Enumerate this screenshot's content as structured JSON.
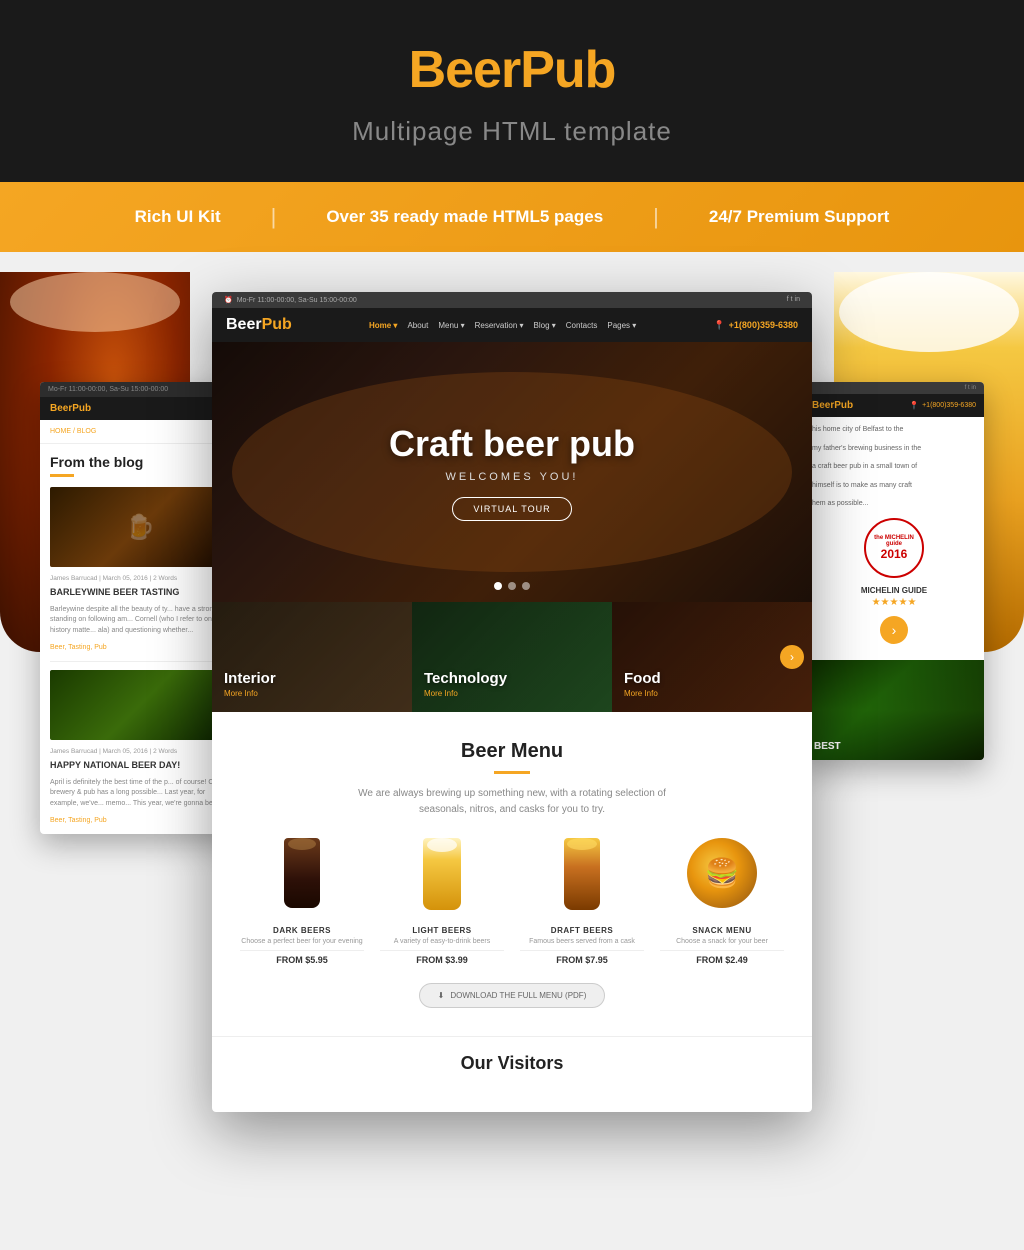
{
  "header": {
    "logo_beer": "Beer",
    "logo_pub": "Pub",
    "subtitle": "Multipage HTML template"
  },
  "banner": {
    "item1": "Rich UI Kit",
    "item2": "Over 35 ready made HTML5 pages",
    "item3": "24/7 Premium Support",
    "divider": "|"
  },
  "browser_center": {
    "nav": {
      "topbar": "Mo-Fr 11:00-00:00, Sa-Su 15:00-00:00",
      "logo_beer": "Beer",
      "logo_pub": "Pub",
      "menu_items": [
        "Home",
        "About",
        "Menu",
        "Reservation",
        "Blog",
        "Contacts",
        "Pages"
      ],
      "phone": "+1(800)359-6380"
    },
    "hero": {
      "title": "Craft beer pub",
      "subtitle": "WELCOMES YOU!",
      "btn": "VIRTUAL TOUR"
    },
    "features": [
      {
        "title": "Interior",
        "link": "More Info"
      },
      {
        "title": "Technology",
        "link": "More Info"
      },
      {
        "title": "Food",
        "link": "More Info"
      }
    ],
    "beer_menu": {
      "title": "Beer Menu",
      "description": "We are always brewing up something new, with a rotating selection of seasonals, nitros, and casks for you to try.",
      "items": [
        {
          "name": "DARK BEERS",
          "desc": "Choose a perfect beer for your evening",
          "price": "FROM $5.95"
        },
        {
          "name": "LIGHT BEERS",
          "desc": "A variety of easy-to-drink beers",
          "price": "FROM $3.99"
        },
        {
          "name": "DRAFT BEERS",
          "desc": "Famous beers served from a cask",
          "price": "FROM $7.95"
        },
        {
          "name": "SNACK MENU",
          "desc": "Choose a snack for your beer",
          "price": "FROM $2.49"
        }
      ],
      "download_btn": "DOWNLOAD THE FULL MENU (PDF)"
    },
    "visitors": {
      "title": "Our Visitors"
    }
  },
  "blog_panel": {
    "logo_beer": "Beer",
    "logo_pub": "Pub",
    "breadcrumb": "HOME / BLOG",
    "heading": "From the blog",
    "post1": {
      "meta": "James Barrucad  |  March 05, 2016  |  2 Words",
      "title": "BARLEYWINE BEER TASTING",
      "text": "Barleywine despite all the beauty of ty... have a strong standing on following am... Cornell (who I refer to on history matte... ala) and questioning whether...",
      "tags": "Beer, Tasting, Pub"
    },
    "post2": {
      "meta": "James Barrucad  |  March 05, 2016  |  2 Words",
      "title": "HAPPY NATIONAL BEER DAY!",
      "text": "April is definitely the best time of the p... of course! Our brewery & pub has a long possible... Last year, for example, we've... memo... This year, we're gonna beat it...",
      "tags": "Beer, Tasting, Pub"
    }
  },
  "right_panel": {
    "logo_beer": "Beer",
    "logo_pub": "Pub",
    "text1": "his home city of Belfast to the",
    "text2": "my father's brewing business in the",
    "text3": "a craft beer pub in a small town of",
    "text4": "himself is to make as many craft",
    "text5": "hem as possible...",
    "michelin": {
      "guide": "the MICHELIN guide",
      "year": "2016",
      "title": "MICHELIN GUIDE",
      "stars": "★★★★★"
    },
    "food_label": "BEST"
  }
}
